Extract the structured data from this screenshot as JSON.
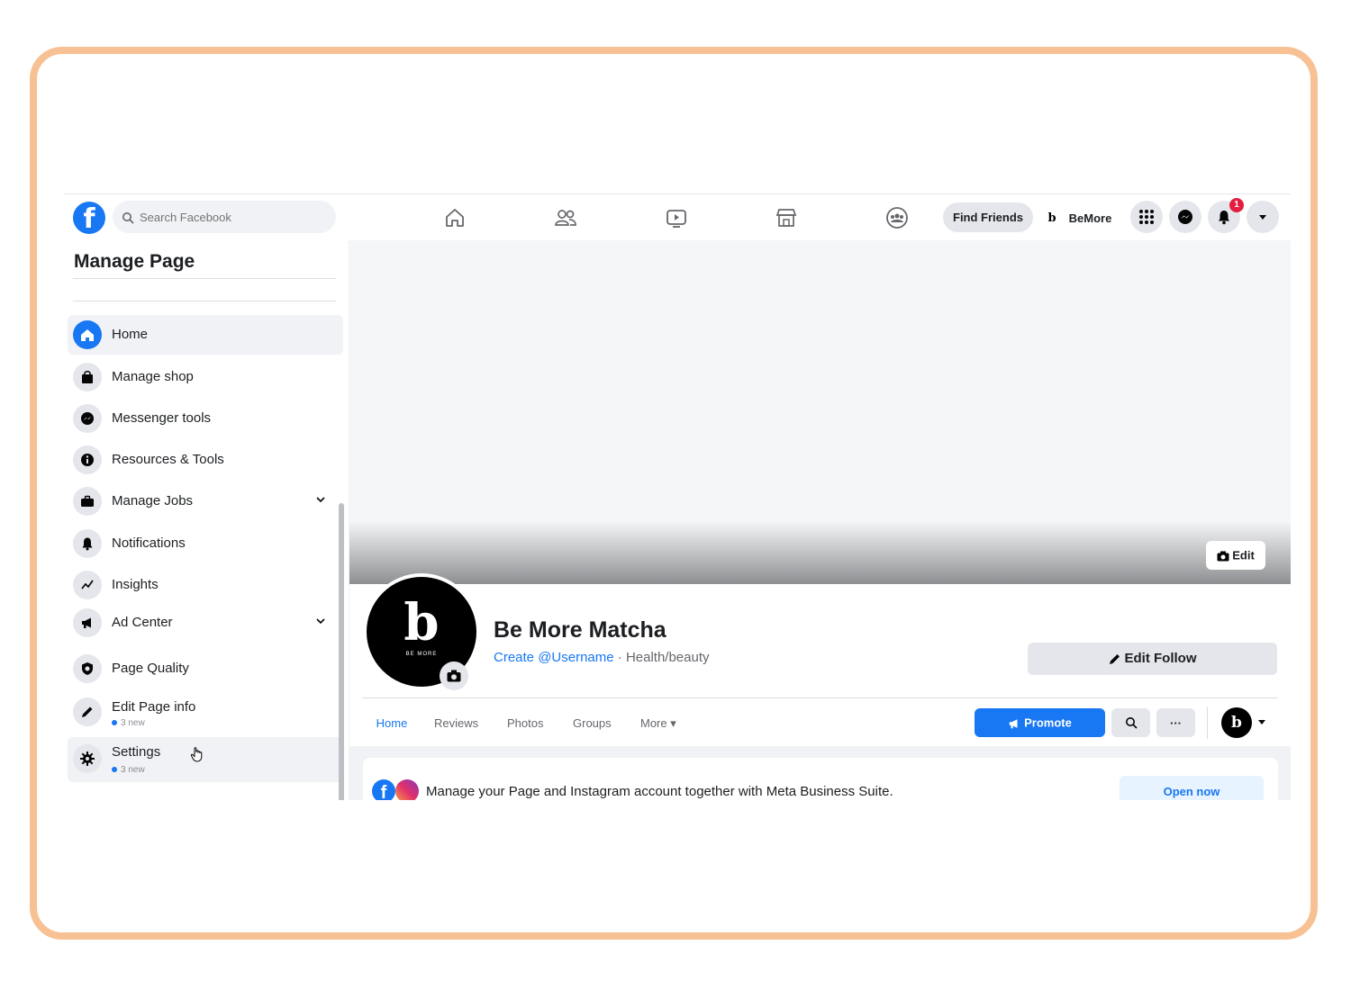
{
  "header": {
    "logo_letter": "f",
    "search_placeholder": "Search Facebook",
    "find_friends_label": "Find Friends",
    "profile_badge": "b",
    "profile_name": "BeMore",
    "notification_count": "1",
    "nav_icons": [
      "home-icon",
      "friends-icon",
      "watch-icon",
      "marketplace-icon",
      "groups-icon"
    ]
  },
  "sidebar": {
    "title": "Manage Page",
    "items": [
      {
        "label": "Home",
        "icon": "home-icon",
        "active": true
      },
      {
        "label": "Manage shop",
        "icon": "shopping-bag-icon"
      },
      {
        "label": "Messenger tools",
        "icon": "messenger-icon"
      },
      {
        "label": "Resources & Tools",
        "icon": "info-icon"
      },
      {
        "label": "Manage Jobs",
        "icon": "briefcase-icon",
        "expandable": true
      },
      {
        "label": "Notifications",
        "icon": "bell-icon"
      },
      {
        "label": "Insights",
        "icon": "insights-icon"
      },
      {
        "label": "Ad Center",
        "icon": "megaphone-icon",
        "expandable": true
      },
      {
        "label": "Page Quality",
        "icon": "shield-icon"
      },
      {
        "label": "Edit Page info",
        "icon": "pencil-icon",
        "sub": "3 new"
      },
      {
        "label": "Settings",
        "icon": "gear-icon",
        "sub": "3 new"
      }
    ]
  },
  "cover": {
    "edit_label": "Edit"
  },
  "page": {
    "avatar_letter": "b",
    "avatar_tagline": "BE MORE",
    "name": "Be More Matcha",
    "username_link": "Create @Username",
    "category": " · Health/beauty",
    "edit_follow_label": "Edit Follow"
  },
  "tabs": [
    {
      "label": "Home",
      "active": true
    },
    {
      "label": "Reviews"
    },
    {
      "label": "Photos"
    },
    {
      "label": "Groups"
    },
    {
      "label": "More ▾"
    }
  ],
  "actions": {
    "promote_label": "Promote",
    "more_label": "···",
    "mini_avatar_letter": "b"
  },
  "banner": {
    "message": "Manage your Page and Instagram account together with Meta Business Suite.",
    "button_label": "Open now"
  },
  "colors": {
    "brand": "#1877f2",
    "frame": "#f7c193",
    "badge": "#e41e3f"
  }
}
